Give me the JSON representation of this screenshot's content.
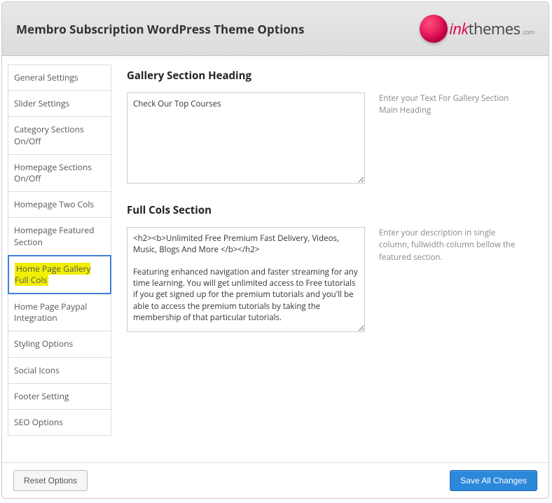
{
  "header": {
    "title": "Membro Subscription WordPress Theme Options",
    "logo_ink": "ink",
    "logo_themes": "themes",
    "logo_tld": ".com"
  },
  "sidebar": {
    "items": [
      {
        "label": "General Settings"
      },
      {
        "label": "Slider Settings"
      },
      {
        "label": "Category Sections On/Off"
      },
      {
        "label": "Homepage Sections On/Off"
      },
      {
        "label": "Homepage Two Cols"
      },
      {
        "label": "Homepage Featured Section"
      },
      {
        "label": "Home Page Gallery Full Cols"
      },
      {
        "label": "Home Page Paypal Integration"
      },
      {
        "label": "Styling Options"
      },
      {
        "label": "Social Icons"
      },
      {
        "label": "Footer Setting"
      },
      {
        "label": "SEO Options"
      }
    ]
  },
  "sections": {
    "gallery": {
      "heading": "Gallery Section Heading",
      "value": "Check Our Top Courses",
      "help": "Enter your Text For Gallery Section Main Heading"
    },
    "fullcols": {
      "heading": "Full Cols Section",
      "value": "<h2><b>Unlimited Free Premium Fast Delivery, Videos, Music, Blogs And More </b></h2>\n\nFeaturing enhanced navigation and faster streaming for any time learning. You will get unlimited access to Free tutorials if you get signed up for the premium tutorials and you'll be able to access the premium tutorials by taking the membership of that particular tutorials.",
      "help": "Enter your description in single column, fullwidth column bellow the featured section."
    }
  },
  "footer": {
    "reset_label": "Reset Options",
    "save_label": "Save All Changes"
  }
}
